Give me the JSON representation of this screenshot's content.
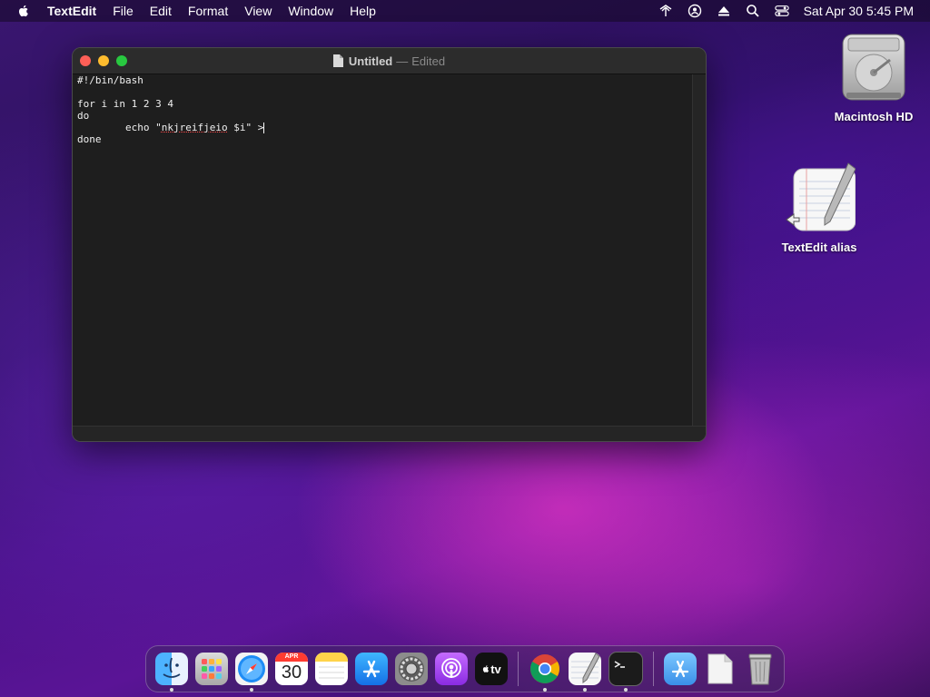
{
  "menubar": {
    "app_name": "TextEdit",
    "menus": [
      "File",
      "Edit",
      "Format",
      "View",
      "Window",
      "Help"
    ],
    "clock": "Sat Apr 30  5:45 PM"
  },
  "window": {
    "title": "Untitled",
    "separator": "—",
    "status": "Edited",
    "lines": [
      "#!/bin/bash",
      "",
      "for i in 1 2 3 4",
      "do",
      "        echo \"nkjreifjeio $i\" >",
      "done"
    ],
    "misspelled_word": "nkjreifjeio"
  },
  "desktop": {
    "icons": [
      {
        "label": "Macintosh HD",
        "icon": "hard-drive-icon"
      },
      {
        "label": "TextEdit alias",
        "icon": "textedit-icon"
      }
    ]
  },
  "dock": {
    "calendar_month": "APR",
    "calendar_day": "30",
    "tv_label": "tv",
    "items": [
      "Finder",
      "Launchpad",
      "Safari",
      "Calendar",
      "Notes",
      "App Store",
      "System Preferences",
      "Podcasts",
      "TV",
      "Chrome",
      "TextEdit",
      "Terminal",
      "Applications",
      "Document",
      "Trash"
    ]
  },
  "colors": {
    "close": "#fe5f57",
    "minimize": "#febc2e",
    "maximize": "#28c840"
  }
}
